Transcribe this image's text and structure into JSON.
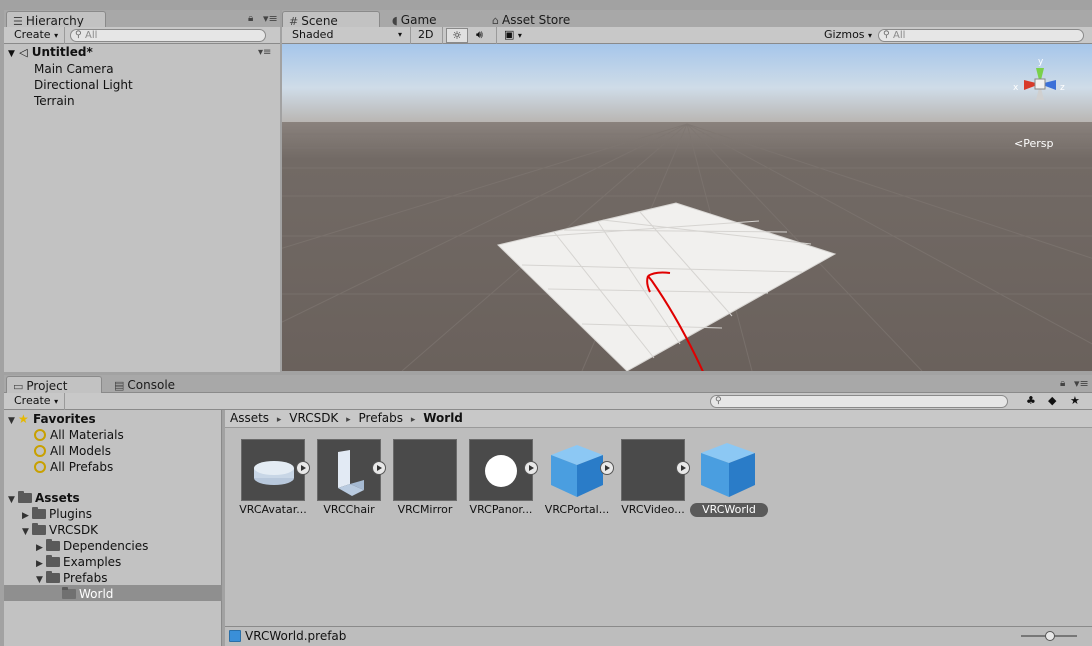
{
  "hierarchy": {
    "tab_label": "Hierarchy",
    "create_label": "Create",
    "search_placeholder": "All",
    "scene_name": "Untitled*",
    "items": [
      {
        "label": "Main Camera"
      },
      {
        "label": "Directional Light"
      },
      {
        "label": "Terrain"
      }
    ]
  },
  "scene_tabs": {
    "scene": "Scene",
    "game": "Game",
    "asset_store": "Asset Store"
  },
  "scene_toolbar": {
    "shading_mode": "Shaded",
    "mode_2d": "2D",
    "gizmos_label": "Gizmos",
    "search_placeholder": "All"
  },
  "scene_view": {
    "projection_label": "Persp",
    "gizmo_axes": {
      "x": "x",
      "y": "y",
      "z": "z"
    }
  },
  "project": {
    "tab_project": "Project",
    "tab_console": "Console",
    "create_label": "Create",
    "favorites": {
      "label": "Favorites",
      "items": [
        "All Materials",
        "All Models",
        "All Prefabs"
      ]
    },
    "assets_tree": {
      "root": "Assets",
      "plugins": "Plugins",
      "vrcsdk": "VRCSDK",
      "dependencies": "Dependencies",
      "examples": "Examples",
      "prefabs": "Prefabs",
      "world": "World"
    },
    "breadcrumb": {
      "assets": "Assets",
      "vrcsdk": "VRCSDK",
      "prefabs": "Prefabs",
      "world": "World"
    },
    "asset_items": [
      {
        "label": "VRCAvatar...",
        "icon": "cylinder-icon"
      },
      {
        "label": "VRCChair",
        "icon": "chair-icon"
      },
      {
        "label": "VRCMirror",
        "icon": "blank-icon"
      },
      {
        "label": "VRCPanor...",
        "icon": "sphere-icon"
      },
      {
        "label": "VRCPortal...",
        "icon": "cube-icon"
      },
      {
        "label": "VRCVideo...",
        "icon": "blank-icon"
      },
      {
        "label": "VRCWorld",
        "icon": "cube-icon",
        "selected": true
      }
    ],
    "status_file": "VRCWorld.prefab"
  },
  "colors": {
    "sky_top": "#a9c8ea",
    "horizon": "#b9b6b3",
    "ground": "#6d645f",
    "annotation": "#e00000",
    "cube_blue": "#3a8fd8",
    "selection": "#5a5a5a"
  }
}
